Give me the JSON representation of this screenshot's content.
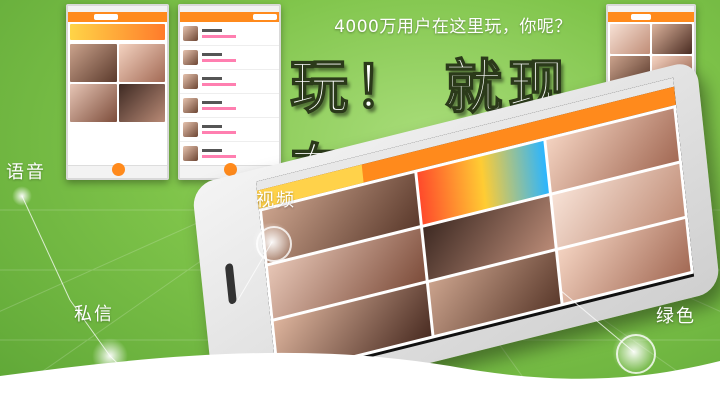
{
  "tagline": "4000万用户在这里玩，你呢？",
  "headline": "玩！ 就现在",
  "features": {
    "voice": "语音",
    "video": "视频",
    "private_message": "私信",
    "green": "绿色"
  },
  "colors": {
    "background": "#7fc44a",
    "accent_orange": "#ff8a1c",
    "text": "#ffffff"
  }
}
